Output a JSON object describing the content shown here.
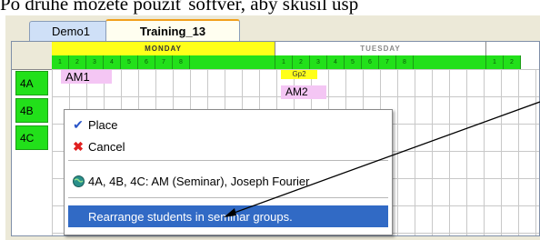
{
  "doc": {
    "top_text": "Po druhé môžete použiť softvér, aby skúsil usp"
  },
  "tabs": [
    {
      "label": "Demo1",
      "active": false
    },
    {
      "label": "Training_13",
      "active": true
    }
  ],
  "timetable": {
    "days": [
      "MONDAY",
      "TUESDAY"
    ],
    "periods_monday": [
      "1",
      "2",
      "3",
      "4",
      "5",
      "6",
      "7",
      "8"
    ],
    "periods_tuesday": [
      "1",
      "2",
      "3",
      "4",
      "5",
      "6",
      "7",
      "8"
    ],
    "periods_wednesday": [
      "1",
      "2"
    ],
    "rows": [
      "4A",
      "4B",
      "4C"
    ],
    "lessons": {
      "am1": "AM1",
      "gp2": "Gp2",
      "am2": "AM2"
    }
  },
  "context_menu": {
    "items": [
      {
        "label": "Place",
        "icon": "checkmark-icon"
      },
      {
        "label": "Cancel",
        "icon": "red-x-icon"
      },
      {
        "label": "4A, 4B, 4C: AM (Seminar), Joseph Fourier",
        "icon": "globe-icon"
      },
      {
        "label": "Rearrange students in seminar groups.",
        "selected": true
      }
    ]
  },
  "colors": {
    "period_green": "#22e01a",
    "day_yellow": "#ffff1a",
    "lesson_pink": "#f4c6f4",
    "selection_blue": "#316ac5",
    "tab_orange": "#f2a01d"
  }
}
